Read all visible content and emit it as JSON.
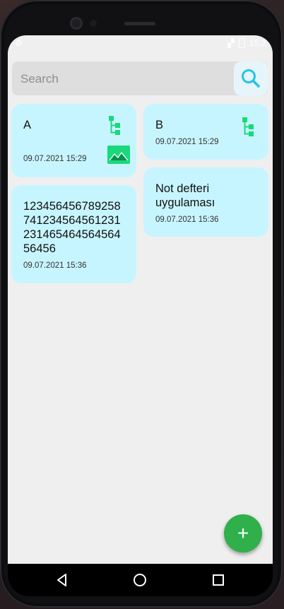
{
  "statusbar": {
    "time": "15:2"
  },
  "search": {
    "placeholder": "Search"
  },
  "notes": [
    {
      "title": "A",
      "date": "09.07.2021 15:29",
      "has_tree_icon": true,
      "has_image_icon": true
    },
    {
      "title": "B",
      "date": "09.07.2021 15:29",
      "has_tree_icon": true,
      "has_image_icon": false
    },
    {
      "title": "123456456789258741234564561231231465464564564456456",
      "display_title": "123456456789258\n741234564561231\n231465464564564\n56456",
      "date": "09.07.2021 15:36"
    },
    {
      "title": "Not defteri uygulaması",
      "display_title": "Not defteri\nuygulaması",
      "date": "09.07.2021 15:36"
    }
  ],
  "fab": {
    "label": "+",
    "icon": "plus-icon"
  },
  "navigation": {
    "icons": [
      "back-icon",
      "home-icon",
      "recents-icon"
    ]
  },
  "colors": {
    "card_bg": "#c7f5ff",
    "accent": "#2fb04a",
    "icon_green": "#19d97a",
    "search_icon": "#25c3e6"
  }
}
